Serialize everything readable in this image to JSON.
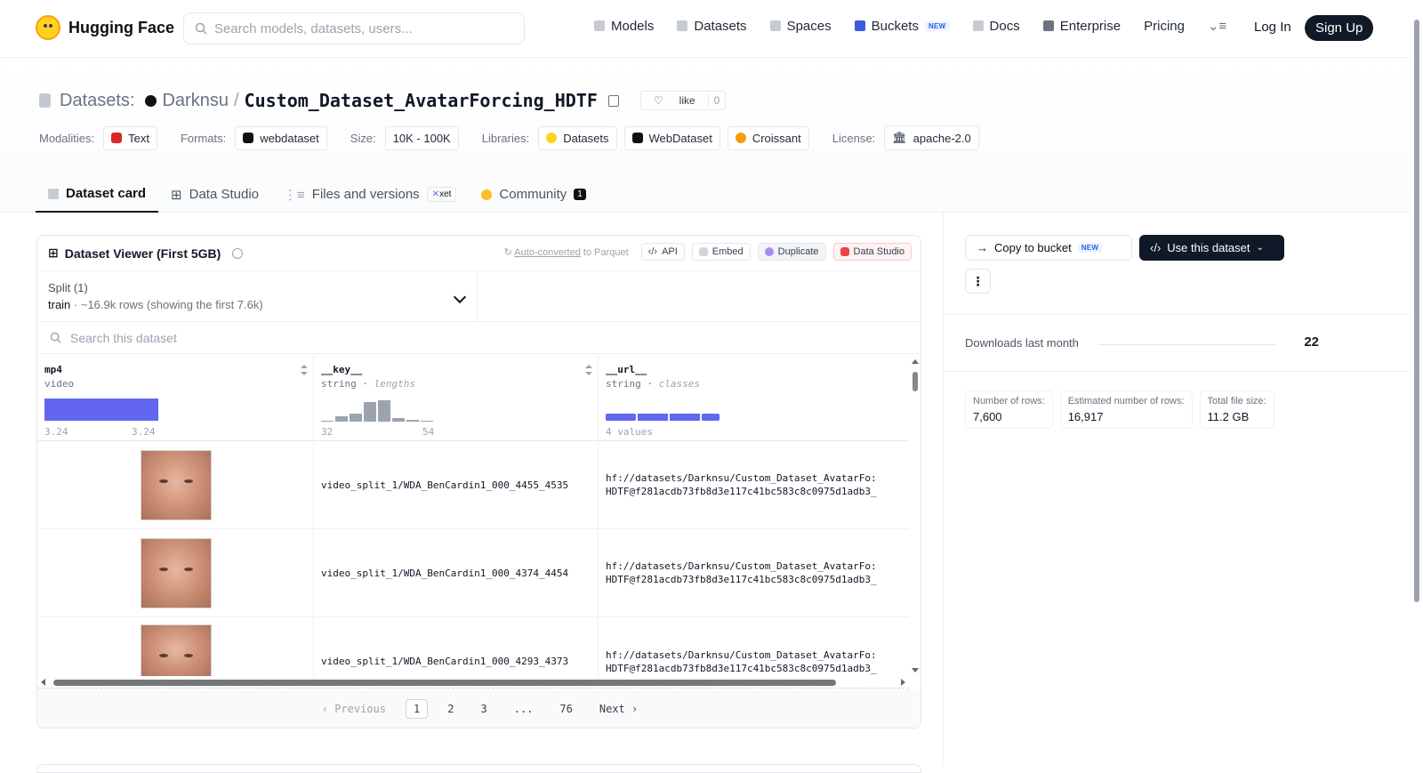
{
  "header": {
    "brand": "Hugging Face",
    "search_placeholder": "Search models, datasets, users...",
    "nav": [
      {
        "label": "Models",
        "icon": "cube-icon"
      },
      {
        "label": "Datasets",
        "icon": "database-icon"
      },
      {
        "label": "Spaces",
        "icon": "grid-icon"
      },
      {
        "label": "Buckets",
        "icon": "bucket-icon",
        "badge": "NEW"
      },
      {
        "label": "Docs",
        "icon": "book-icon"
      },
      {
        "label": "Enterprise",
        "icon": "enterprise-icon"
      },
      {
        "label": "Pricing"
      }
    ],
    "login": "Log In",
    "signup": "Sign Up"
  },
  "repo": {
    "type_label": "Datasets:",
    "owner": "Darknsu",
    "name": "Custom_Dataset_AvatarForcing_HDTF",
    "like_label": "like",
    "like_count": "0",
    "tags": {
      "modalities_label": "Modalities:",
      "modality": "Text",
      "formats_label": "Formats:",
      "format": "webdataset",
      "size_label": "Size:",
      "size": "10K - 100K",
      "libraries_label": "Libraries:",
      "libraries": [
        "Datasets",
        "WebDataset",
        "Croissant"
      ],
      "license_label": "License:",
      "license": "apache-2.0"
    },
    "tabs": {
      "card": "Dataset card",
      "studio": "Data Studio",
      "files": "Files and versions",
      "xet": "xet",
      "community": "Community",
      "community_count": "1"
    }
  },
  "viewer": {
    "title": "Dataset Viewer (First 5GB)",
    "autoconv_link": "Auto-converted",
    "autoconv_rest": "to Parquet",
    "api": "API",
    "embed": "Embed",
    "duplicate": "Duplicate",
    "studio": "Data Studio",
    "split_label": "Split (1)",
    "split_name": "train",
    "split_rows": "~16.9k rows (showing the first 7.6k)",
    "search_placeholder": "Search this dataset",
    "columns": [
      {
        "name": "mp4",
        "type": "video",
        "range_min": "3.24",
        "range_max": "3.24"
      },
      {
        "name": "__key__",
        "type": "string",
        "stat": "lengths",
        "range_min": "32",
        "range_max": "54"
      },
      {
        "name": "__url__",
        "type": "string",
        "stat": "classes",
        "summary": "4 values"
      }
    ],
    "rows": [
      {
        "key": "video_split_1/WDA_BenCardin1_000_4455_4535",
        "url1": "hf://datasets/Darknsu/Custom_Dataset_AvatarFo:",
        "url2": "HDTF@f281acdb73fb8d3e117c41bc583c8c0975d1adb3_"
      },
      {
        "key": "video_split_1/WDA_BenCardin1_000_4374_4454",
        "url1": "hf://datasets/Darknsu/Custom_Dataset_AvatarFo:",
        "url2": "HDTF@f281acdb73fb8d3e117c41bc583c8c0975d1adb3_"
      },
      {
        "key": "video_split_1/WDA_BenCardin1_000_4293_4373",
        "url1": "hf://datasets/Darknsu/Custom_Dataset_AvatarFo:",
        "url2": "HDTF@f281acdb73fb8d3e117c41bc583c8c0975d1adb3_"
      }
    ],
    "pager": {
      "prev": "Previous",
      "pages": [
        "1",
        "2",
        "3",
        "...",
        "76"
      ],
      "next": "Next"
    }
  },
  "sidebar": {
    "copy_bucket": "Copy to bucket",
    "copy_badge": "NEW",
    "use_dataset": "Use this dataset",
    "more": "⋮",
    "downloads_label": "Downloads last month",
    "downloads": "22",
    "stats": [
      {
        "label": "Number of rows:",
        "value": "7,600"
      },
      {
        "label": "Estimated number of rows:",
        "value": "16,917"
      },
      {
        "label": "Total file size:",
        "value": "11.2 GB"
      }
    ]
  }
}
